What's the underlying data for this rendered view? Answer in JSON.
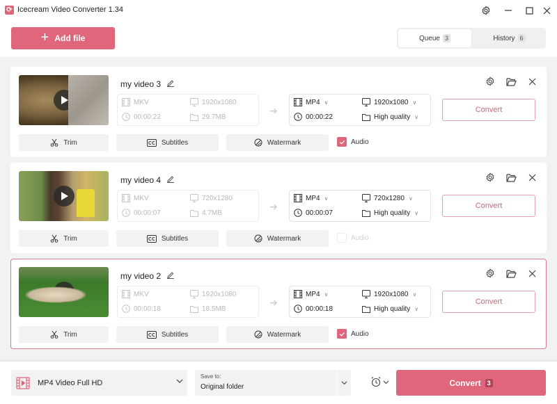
{
  "app": {
    "title": "Icecream Video Converter 1.34",
    "accent_color": "#e0677b"
  },
  "header": {
    "add_file_label": "Add file",
    "tabs": [
      {
        "label": "Queue",
        "count": "3",
        "active": true
      },
      {
        "label": "History",
        "count": "6",
        "active": false
      }
    ]
  },
  "queue": [
    {
      "name": "my video 3",
      "thumbnail": "lion",
      "source": {
        "format": "MKV",
        "resolution": "1920x1080",
        "duration": "00:00:22",
        "size": "29.7MB"
      },
      "target": {
        "format": "MP4",
        "resolution": "1920x1080",
        "duration": "00:00:22",
        "quality": "High quality"
      },
      "convert_label": "Convert",
      "actions": {
        "trim": "Trim",
        "subtitles": "Subtitles",
        "watermark": "Watermark"
      },
      "audio": {
        "label": "Audio",
        "checked": true,
        "enabled": true
      },
      "selected": false
    },
    {
      "name": "my video 4",
      "thumbnail": "tree",
      "source": {
        "format": "MKV",
        "resolution": "720x1280",
        "duration": "00:00:07",
        "size": "4.7MB"
      },
      "target": {
        "format": "MP4",
        "resolution": "720x1280",
        "duration": "00:00:07",
        "quality": "High quality"
      },
      "convert_label": "Convert",
      "actions": {
        "trim": "Trim",
        "subtitles": "Subtitles",
        "watermark": "Watermark"
      },
      "audio": {
        "label": "Audio",
        "checked": false,
        "enabled": false
      },
      "selected": false
    },
    {
      "name": "my video 2",
      "thumbnail": "cheetah",
      "source": {
        "format": "MKV",
        "resolution": "1920x1080",
        "duration": "00:00:18",
        "size": "18.5MB"
      },
      "target": {
        "format": "MP4",
        "resolution": "1920x1080",
        "duration": "00:00:18",
        "quality": "High quality"
      },
      "convert_label": "Convert",
      "actions": {
        "trim": "Trim",
        "subtitles": "Subtitles",
        "watermark": "Watermark"
      },
      "audio": {
        "label": "Audio",
        "checked": true,
        "enabled": true
      },
      "selected": true
    }
  ],
  "footer": {
    "preset_label": "MP4 Video Full HD",
    "save_to_caption": "Save to:",
    "save_to_value": "Original folder",
    "convert_label": "Convert",
    "convert_count": "3"
  }
}
